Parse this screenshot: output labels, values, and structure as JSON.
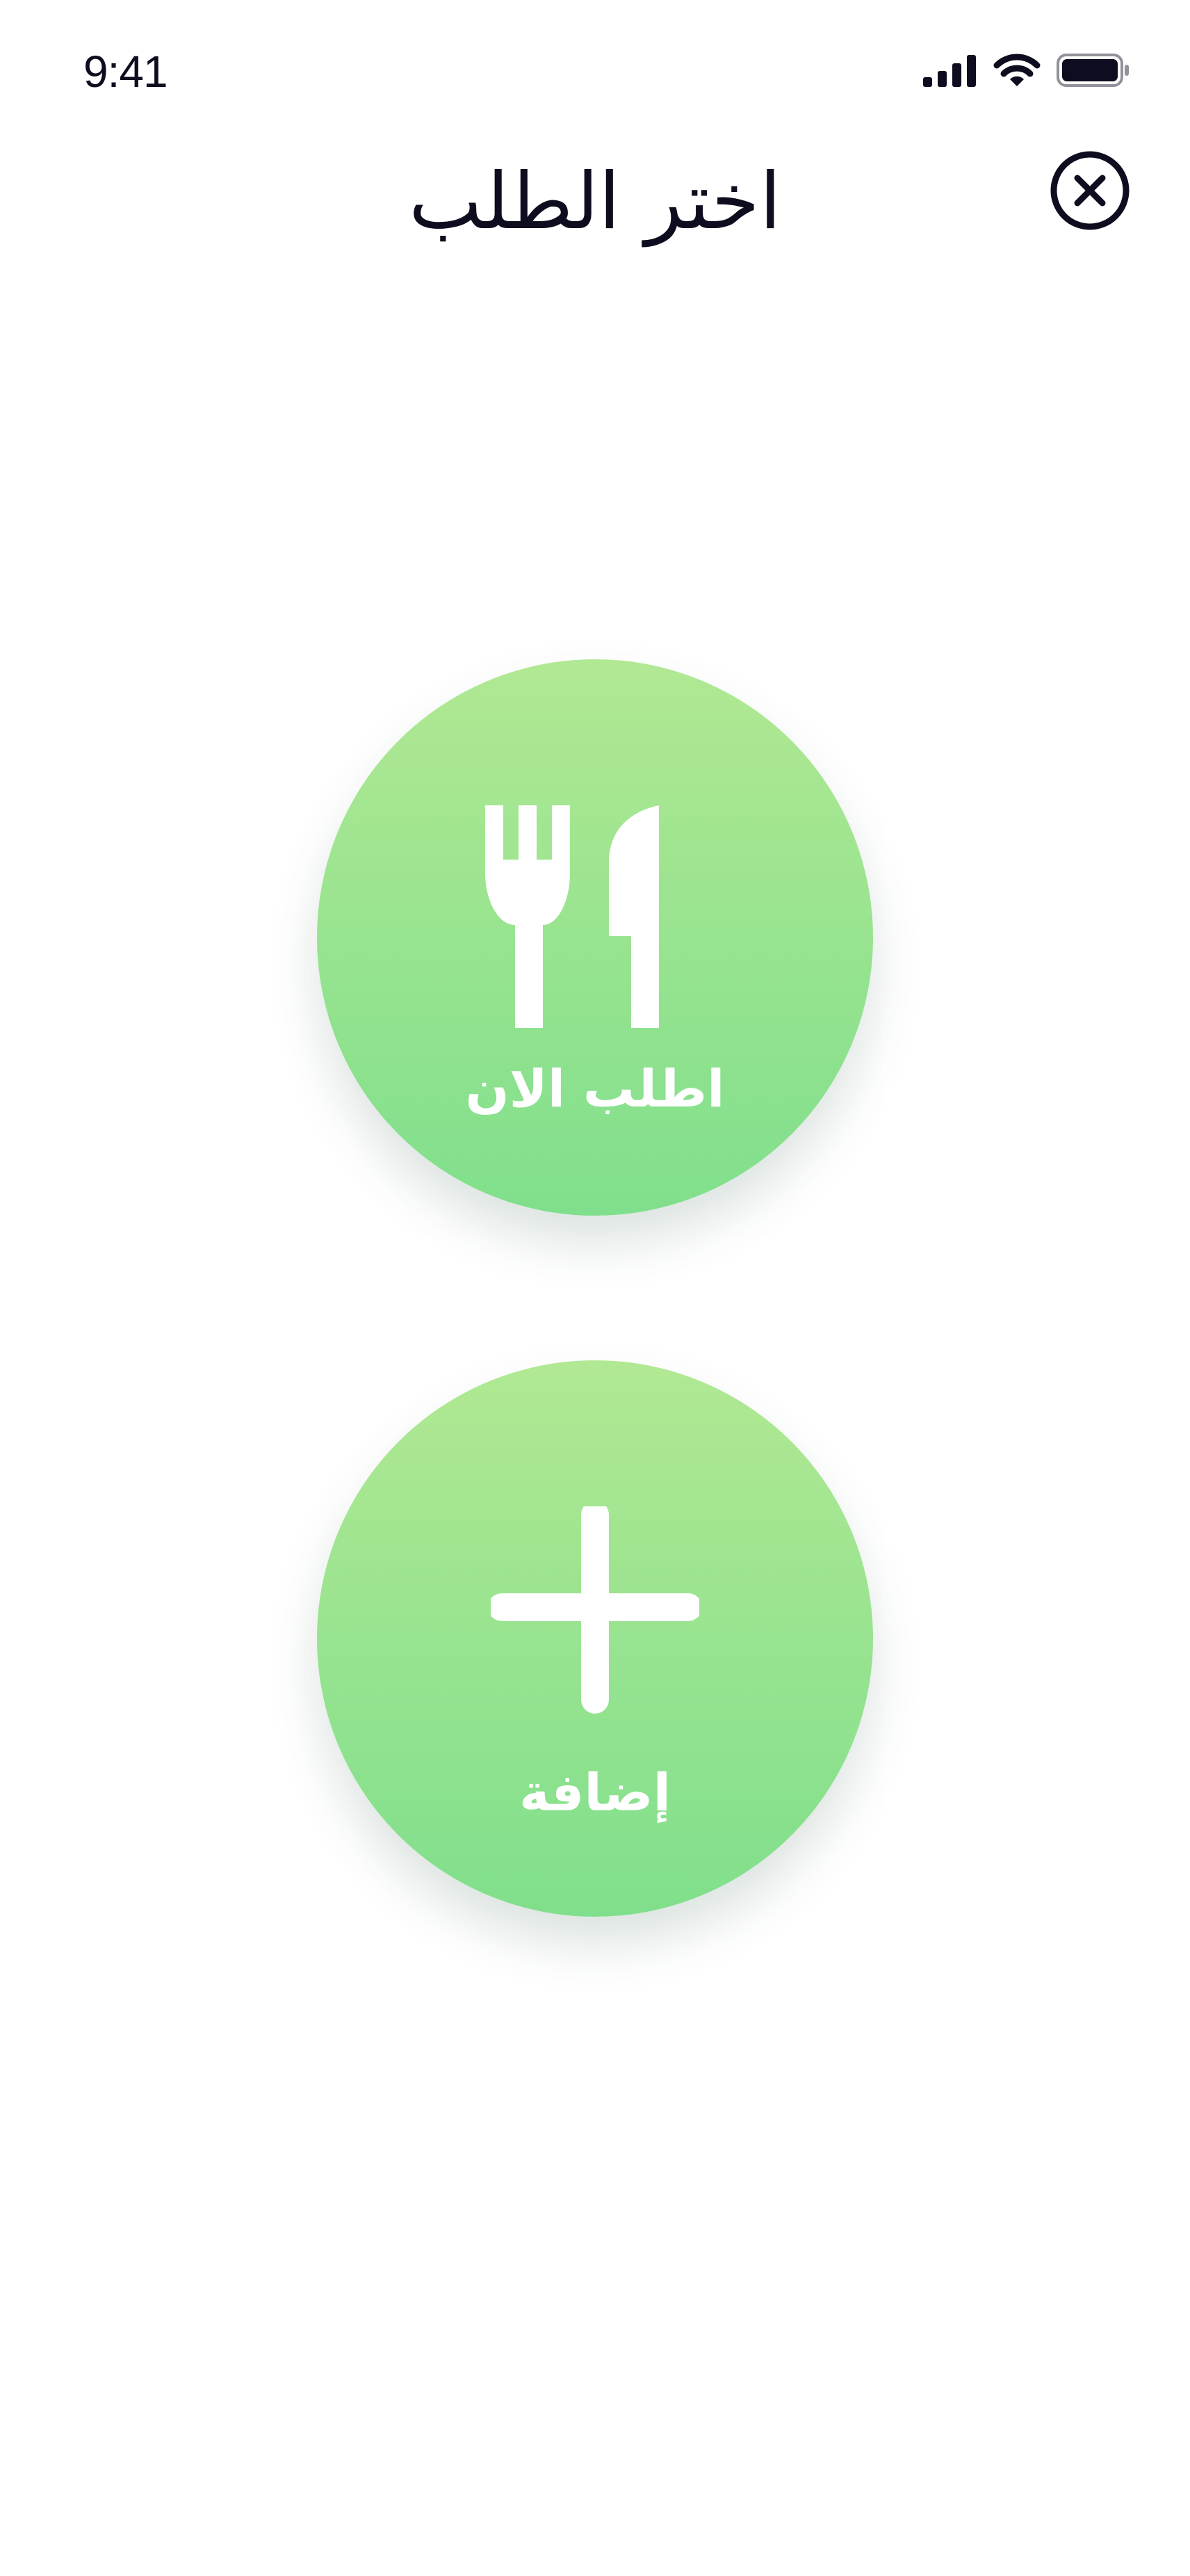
{
  "status_bar": {
    "time": "9:41",
    "icons": [
      "cellular-signal-icon",
      "wifi-icon",
      "battery-icon"
    ]
  },
  "header": {
    "title": "اختر الطلب",
    "close_icon": "close-circle-icon"
  },
  "actions": [
    {
      "label": "اطلب الان",
      "icon": "fork-knife-icon"
    },
    {
      "label": "إضافة",
      "icon": "plus-icon"
    }
  ],
  "colors": {
    "gradient_top": "#b1e893",
    "gradient_bottom": "#80df8c",
    "text_dark": "#0d0d1f",
    "icon_white": "#ffffff"
  }
}
